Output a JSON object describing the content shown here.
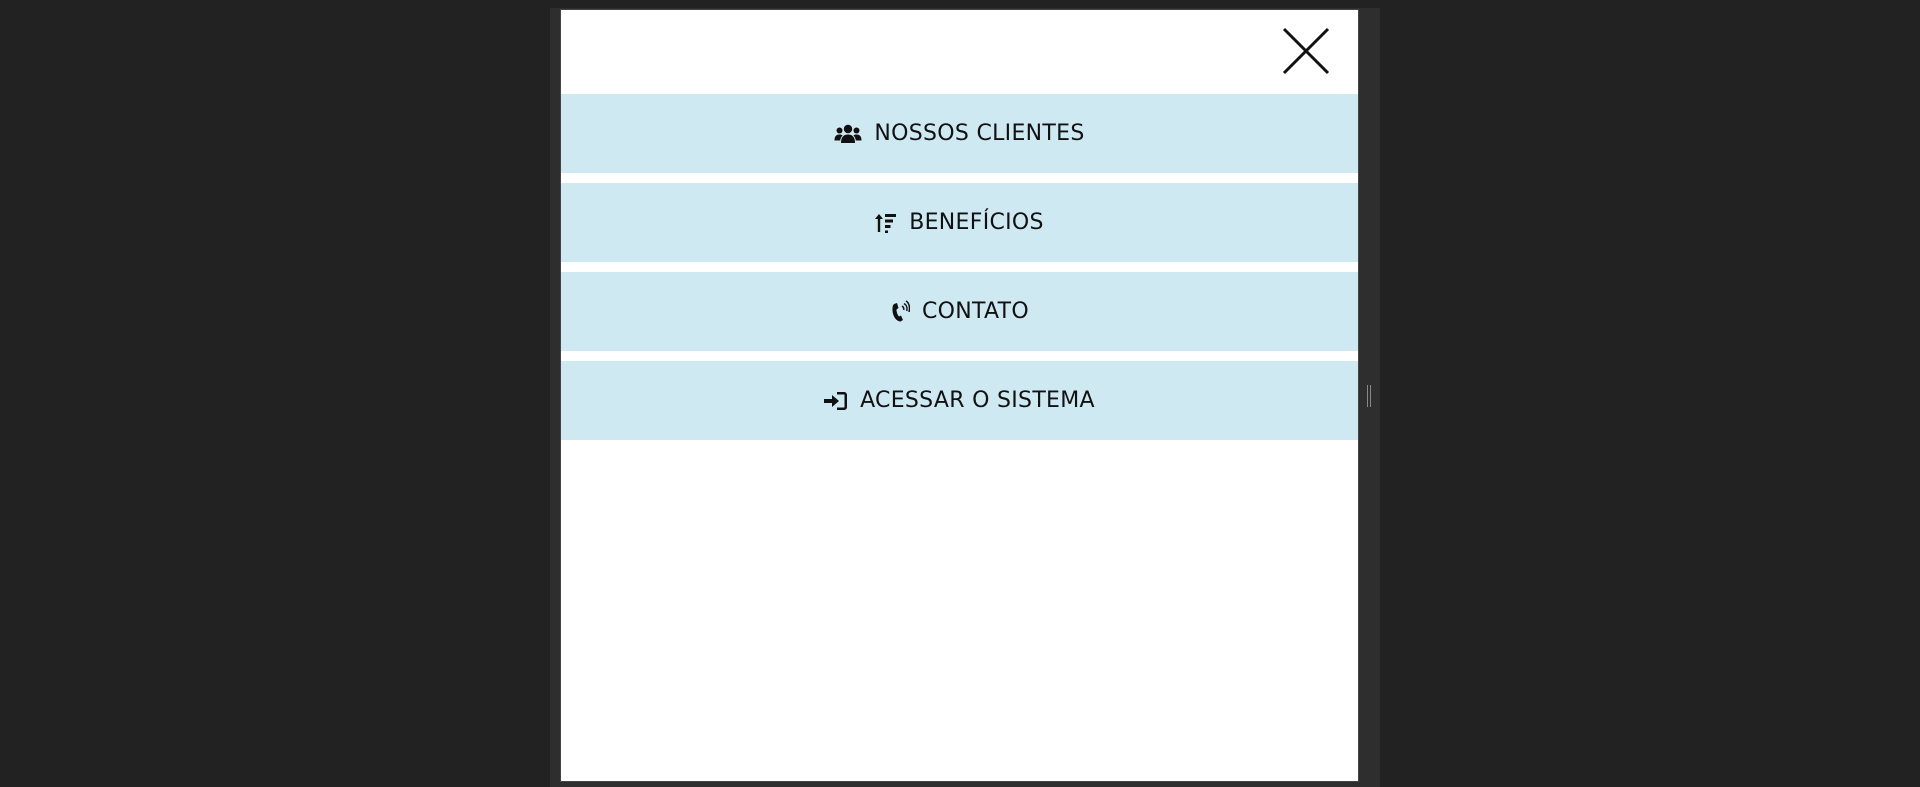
{
  "overlay": {
    "close_icon": "close-icon"
  },
  "menu": {
    "items": [
      {
        "label": "NOSSOS CLIENTES",
        "icon": "users-icon"
      },
      {
        "label": "BENEFÍCIOS",
        "icon": "sort-amount-up-icon"
      },
      {
        "label": "CONTATO",
        "icon": "phone-volume-icon"
      },
      {
        "label": "ACESSAR O SISTEMA",
        "icon": "sign-in-icon"
      }
    ]
  },
  "colors": {
    "backdrop": "#222222",
    "modal_bg": "#ffffff",
    "menu_item_bg": "#cfe9f3",
    "text": "#111111"
  }
}
